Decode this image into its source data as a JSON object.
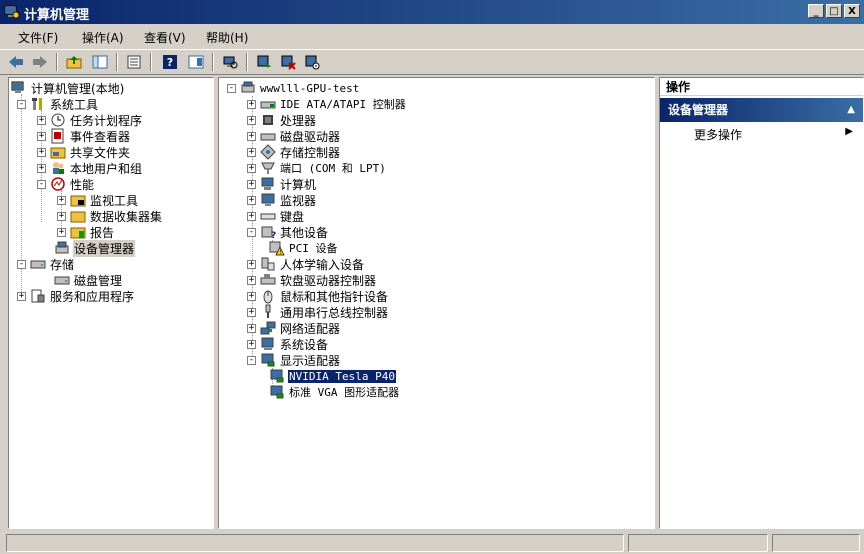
{
  "window": {
    "title": "计算机管理",
    "controls": [
      "_",
      "□",
      "X"
    ]
  },
  "menu": [
    "文件(F)",
    "操作(A)",
    "查看(V)",
    "帮助(H)"
  ],
  "toolbar": [
    "back",
    "forward",
    "up",
    "show-hide-tree",
    "export",
    "help",
    "properties",
    "scan",
    "update",
    "uninstall",
    "disable"
  ],
  "left_tree": {
    "root": "计算机管理(本地)",
    "system_tools": "系统工具",
    "task_scheduler": "任务计划程序",
    "event_viewer": "事件查看器",
    "shared_folders": "共享文件夹",
    "local_users": "本地用户和组",
    "performance": "性能",
    "monitoring_tools": "监视工具",
    "data_collector": "数据收集器集",
    "reports": "报告",
    "device_manager": "设备管理器",
    "storage": "存储",
    "disk_management": "磁盘管理",
    "services_apps": "服务和应用程序"
  },
  "center_tree": {
    "root": "wwwlll-GPU-test",
    "ide": "IDE ATA/ATAPI 控制器",
    "cpu": "处理器",
    "disk": "磁盘驱动器",
    "storage_ctrl": "存储控制器",
    "ports": "端口 (COM 和 LPT)",
    "computer": "计算机",
    "monitor": "监视器",
    "keyboard": "键盘",
    "other": "其他设备",
    "pci": "PCI 设备",
    "hid": "人体学输入设备",
    "floppy": "软盘驱动器控制器",
    "mouse": "鼠标和其他指针设备",
    "usb": "通用串行总线控制器",
    "network": "网络适配器",
    "system": "系统设备",
    "display": "显示适配器",
    "nvidia": "NVIDIA Tesla P40",
    "vga": "标准 VGA 图形适配器"
  },
  "actions": {
    "header": "操作",
    "group": "设备管理器",
    "more": "更多操作"
  },
  "colors": {
    "titlebar": "#0a246a",
    "selection": "#0a246a",
    "chrome": "#d4d0c8"
  }
}
